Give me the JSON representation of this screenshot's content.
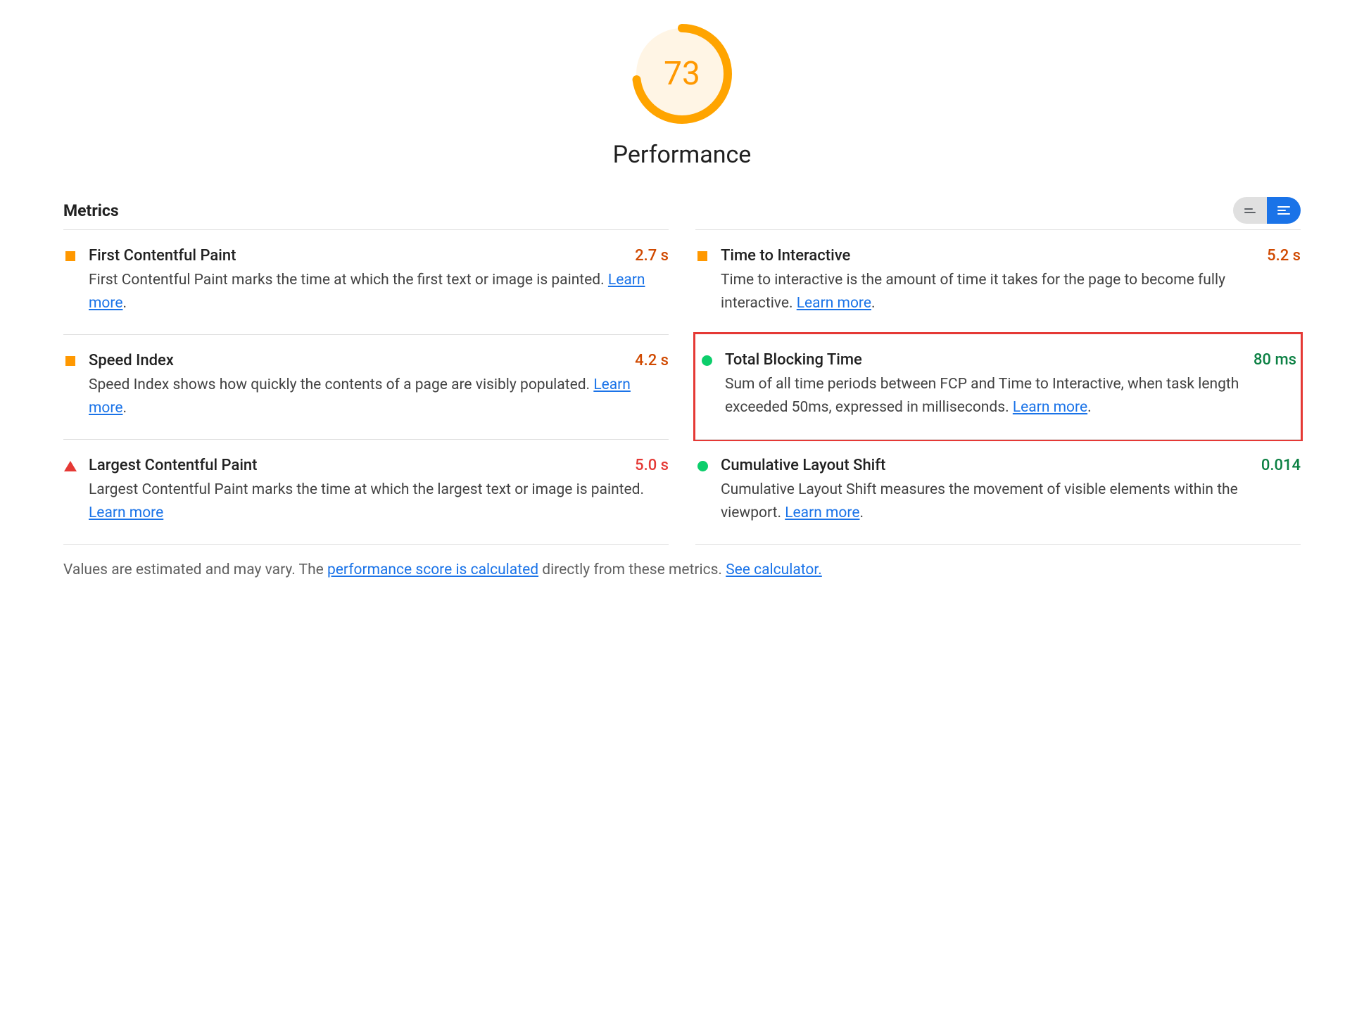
{
  "gauge": {
    "score": "73",
    "label": "Performance",
    "color": "#ffa400",
    "bg_color": "#fff5e5",
    "percent": 73
  },
  "metrics_section": {
    "title": "Metrics"
  },
  "metrics": {
    "fcp": {
      "title": "First Contentful Paint",
      "value": "2.7 s",
      "description": "First Contentful Paint marks the time at which the first text or image is painted. ",
      "learn_more": "Learn more",
      "trail": "."
    },
    "tti": {
      "title": "Time to Interactive",
      "value": "5.2 s",
      "description": "Time to interactive is the amount of time it takes for the page to become fully interactive. ",
      "learn_more": "Learn more",
      "trail": "."
    },
    "si": {
      "title": "Speed Index",
      "value": "4.2 s",
      "description": "Speed Index shows how quickly the contents of a page are visibly populated. ",
      "learn_more": "Learn more",
      "trail": "."
    },
    "tbt": {
      "title": "Total Blocking Time",
      "value": "80 ms",
      "description": "Sum of all time periods between FCP and Time to Interactive, when task length exceeded 50ms, expressed in milliseconds. ",
      "learn_more": "Learn more",
      "trail": "."
    },
    "lcp": {
      "title": "Largest Contentful Paint",
      "value": "5.0 s",
      "description": "Largest Contentful Paint marks the time at which the largest text or image is painted. ",
      "learn_more": "Learn more",
      "trail": ""
    },
    "cls": {
      "title": "Cumulative Layout Shift",
      "value": "0.014",
      "description": "Cumulative Layout Shift measures the movement of visible elements within the viewport. ",
      "learn_more": "Learn more",
      "trail": "."
    }
  },
  "footer": {
    "prefix": "Values are estimated and may vary. The ",
    "link1": "performance score is calculated",
    "middle": " directly from these metrics. ",
    "link2": "See calculator."
  }
}
